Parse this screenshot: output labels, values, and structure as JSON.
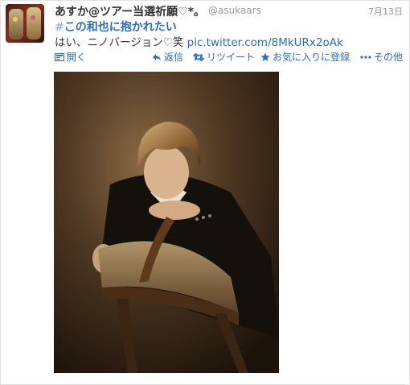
{
  "tweet": {
    "author_name": "あすか@ツアー当選祈願♡*。",
    "handle": "@asukaars",
    "date": "7月13日",
    "hashtag_symbol": "#",
    "hashtag_text": "この和也に抱かれたい",
    "body_text": "はい、ニノバージョン♡笑 ",
    "link_text": "pic.twitter.com/8MkURx2oAk"
  },
  "actions": {
    "open_label": "開く",
    "reply_label": "返信",
    "retweet_label": "リツイート",
    "favorite_label": "お気に入りに登録",
    "more_label": "その他"
  },
  "colors": {
    "link": "#2a6dc0",
    "text": "#333333",
    "muted": "#999999"
  },
  "icons": [
    "open-icon",
    "reply-icon",
    "retweet-icon",
    "favorite-star-icon",
    "more-dots-icon"
  ]
}
